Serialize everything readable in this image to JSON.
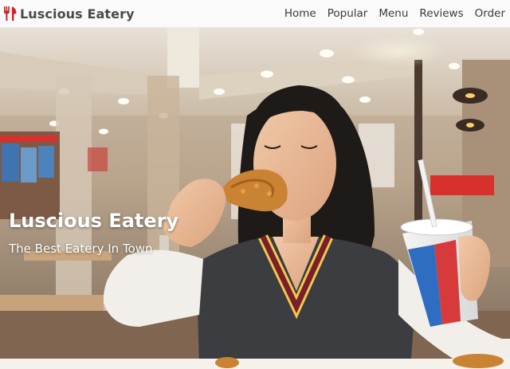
{
  "navbar": {
    "brand": {
      "icon": "fork-knife-icon",
      "name": "Luscious Eatery",
      "color": "#d61f26"
    },
    "links": [
      {
        "label": "Home"
      },
      {
        "label": "Popular"
      },
      {
        "label": "Menu"
      },
      {
        "label": "Reviews"
      },
      {
        "label": "Order"
      }
    ]
  },
  "hero": {
    "image": "girl-eating-fried-chicken-photo",
    "title": "Luscious Eatery",
    "subtitle": "The Best Eatery In Town"
  }
}
